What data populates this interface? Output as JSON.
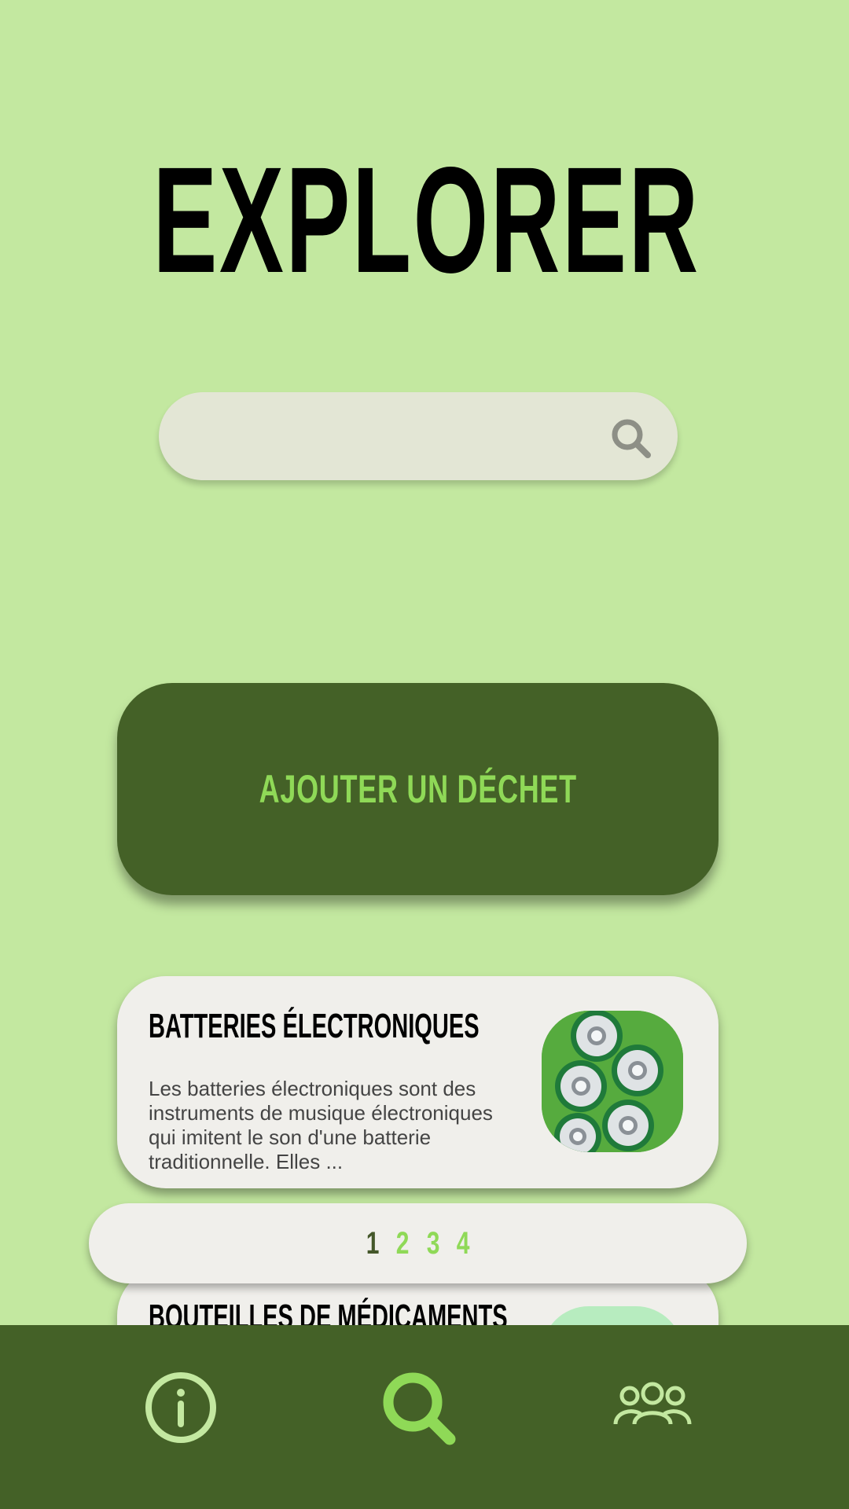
{
  "page": {
    "title": "EXPLORER"
  },
  "search": {
    "placeholder": "",
    "value": "",
    "icon": "search-icon"
  },
  "add_button": {
    "label": "AJOUTER UN DÉCHET"
  },
  "cards": [
    {
      "title": "BATTERIES ÉLECTRONIQUES",
      "description": "Les batteries électroniques sont des instruments de musique électroniques qui imitent le son d'une batterie traditionnelle. Elles ...",
      "image": "batteries-image"
    },
    {
      "title": "BOUTEILLES DE MÉDICAMENTS",
      "description": "",
      "image": "medicine-bottles-image"
    }
  ],
  "pagination": {
    "pages": [
      "1",
      "2",
      "3",
      "4"
    ],
    "current": "1"
  },
  "nav": {
    "items": [
      {
        "icon": "info-icon"
      },
      {
        "icon": "search-icon",
        "active": true
      },
      {
        "icon": "community-icon"
      }
    ]
  },
  "colors": {
    "background": "#c3e8a0",
    "dark_green": "#446127",
    "accent_green": "#8fd957",
    "card": "#f0efeb",
    "search_bg": "#e3e6d5"
  }
}
